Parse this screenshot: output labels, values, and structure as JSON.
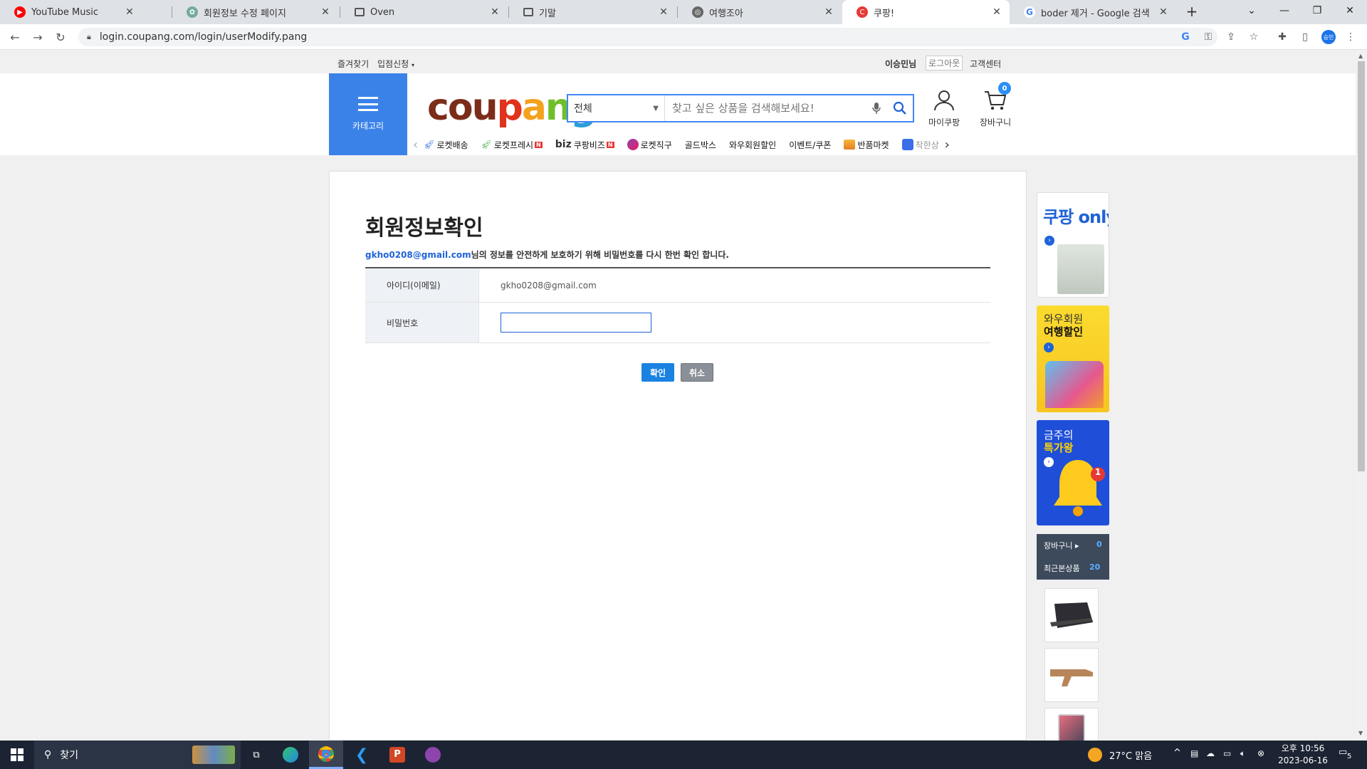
{
  "browser": {
    "tabs": [
      {
        "title": "YouTube Music",
        "icon": "youtube-music-icon",
        "color": "#ff0000"
      },
      {
        "title": "회원정보 수정 페이지",
        "icon": "chatgpt-icon",
        "color": "#74aa9c"
      },
      {
        "title": "Oven",
        "icon": "page-icon",
        "color": "#555555"
      },
      {
        "title": "기말",
        "icon": "page-icon",
        "color": "#555555"
      },
      {
        "title": "여행조아",
        "icon": "globe-icon",
        "color": "#555555"
      },
      {
        "title": "쿠팡!",
        "icon": "coupang-icon",
        "color": "#e53935",
        "active": true
      },
      {
        "title": "boder 제거 - Google 검색",
        "icon": "google-icon",
        "color": "#4285f4"
      }
    ],
    "new_tab": "+",
    "url": "login.coupang.com/login/userModify.pang",
    "profile": "승민"
  },
  "topbar": {
    "favorites": "즐겨찾기",
    "seller": "입점신청",
    "username": "이승민님",
    "logout": "로그아웃",
    "support": "고객센터"
  },
  "header": {
    "category_label": "카테고리",
    "logo": {
      "letters": [
        {
          "ch": "c",
          "color": "#7b2d1a"
        },
        {
          "ch": "o",
          "color": "#7b2d1a"
        },
        {
          "ch": "u",
          "color": "#7b2d1a"
        },
        {
          "ch": "p",
          "color": "#e0321c"
        },
        {
          "ch": "a",
          "color": "#f3a21d"
        },
        {
          "ch": "n",
          "color": "#6fbf2b"
        },
        {
          "ch": "g",
          "color": "#2b9ed9"
        }
      ]
    },
    "search": {
      "category": "전체",
      "placeholder": "찾고 싶은 상품을 검색해보세요!"
    },
    "mycoupang": "마이쿠팡",
    "cart": "장바구니",
    "cart_count": "0",
    "nav": [
      {
        "label": "로켓배송",
        "icon": "rocket-icon"
      },
      {
        "label": "로켓프레시",
        "icon": "rocket-fresh-icon",
        "badge": "N"
      },
      {
        "label": "쿠팡비즈",
        "prefix": "biz",
        "badge": "N"
      },
      {
        "label": "로켓직구",
        "icon": "global-rocket-icon"
      },
      {
        "label": "골드박스"
      },
      {
        "label": "와우회원할인"
      },
      {
        "label": "이벤트/쿠폰"
      },
      {
        "label": "반품마켓",
        "icon": "return-market-icon"
      },
      {
        "label": "착한상",
        "icon": "good-shop-icon"
      }
    ]
  },
  "form": {
    "title": "회원정보확인",
    "email": "gkho0208@gmail.com",
    "desc_suffix": "님의 정보를 안전하게 보호하기 위해 비밀번호를 다시 한번 확인 합니다.",
    "id_label": "아이디(이메일)",
    "id_value": "gkho0208@gmail.com",
    "pw_label": "비밀번호",
    "confirm": "확인",
    "cancel": "취소"
  },
  "sidebar": {
    "banner1_title": "쿠팡 only",
    "banner2_line1": "와우회원",
    "banner2_line2": "여행할인",
    "banner3_line1": "금주의",
    "banner3_line2": "특가왕",
    "banner3_badge": "1",
    "cart_label": "장바구니",
    "cart_count": "0",
    "recent_label": "최근본상품",
    "recent_count": "20"
  },
  "taskbar": {
    "search": "찾기",
    "weather": "27°C 맑음",
    "time": "오후 10:56",
    "date": "2023-06-16",
    "notifications": "5"
  }
}
